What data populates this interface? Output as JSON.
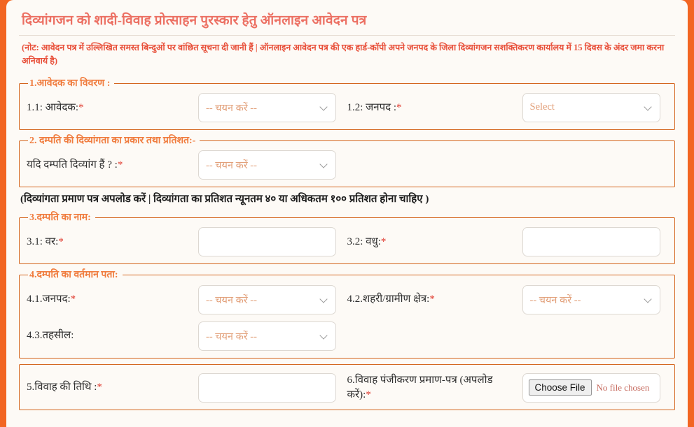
{
  "theme": {
    "page_border": "#f26522",
    "panel_bg": "#fdfaf6",
    "title_color": "#ec7063",
    "note_color": "#e8503a",
    "legend_color": "#f07c3e",
    "fieldset_border": "#d4661f",
    "placeholder_color": "#e2a07a",
    "required_color": "#e03b2f"
  },
  "header": {
    "title": "दिव्यांगजन को शादी-विवाह प्रोत्साहन पुरस्कार हेतु ऑनलाइन आवेदन पत्र",
    "note": "(नोट: आवेदन पत्र में उल्लिखित समस्त बिन्दुओं पर वांछित सूचना दी जानी हैं | ऑनलाइन आवेदन पत्र की एक हार्ड-कॉपी अपने जनपद के जिला दिव्यांगजन सशक्तिकरण कार्यालय में 15 दिवस के अंदर जमा करना अनिवार्य है)"
  },
  "sections": [
    {
      "legend": "1.आवेदक का विवरण :",
      "rows": [
        {
          "left": {
            "label": "1.1: आवेदक:",
            "required": true,
            "control": "select",
            "value": "-- चयन करें --"
          },
          "right": {
            "label": "1.2: जनपद :",
            "required": true,
            "control": "select",
            "value": "Select"
          }
        }
      ]
    },
    {
      "legend": "2. दम्पति की दिव्यांगता का प्रकार तथा प्रतिशत:-",
      "rows": [
        {
          "left": {
            "label": "यदि दम्पति दिव्यांग हैं ? :",
            "required": true,
            "control": "select",
            "value": "-- चयन करें --"
          },
          "right": null
        }
      ]
    },
    {
      "legend": "3.दम्पति का नाम:",
      "rows": [
        {
          "left": {
            "label": "3.1: वर:",
            "required": true,
            "control": "text",
            "value": ""
          },
          "right": {
            "label": "3.2: वधु:",
            "required": true,
            "control": "text",
            "value": ""
          }
        }
      ]
    },
    {
      "legend": "4.दम्पति का वर्तमान पता:",
      "rows": [
        {
          "left": {
            "label": "4.1.जनपद:",
            "required": true,
            "control": "select",
            "value": "-- चयन करें --"
          },
          "right": {
            "label": "4.2.शहरी/ग्रामीण क्षेत्र:",
            "required": true,
            "control": "select",
            "value": "-- चयन करें --"
          }
        },
        {
          "left": {
            "label": "4.3.तहसील:",
            "required": false,
            "control": "select",
            "value": "-- चयन करें --"
          },
          "right": null
        }
      ]
    },
    {
      "legend": "",
      "rows": [
        {
          "left": {
            "label": "5.विवाह की तिथि :",
            "required": true,
            "control": "text",
            "value": ""
          },
          "right": {
            "label": "6.विवाह पंजीकरण प्रमाण-पत्र (अपलोड करें):",
            "required": true,
            "control": "file",
            "value": ""
          }
        }
      ]
    }
  ],
  "inline_note": "(दिव्यांगता प्रमाण पत्र अपलोड करें | दिव्यांगता का प्रतिशत न्यूनतम ४० या अधिकतम १०० प्रतिशत होना चाहिए )",
  "file_input": {
    "button_label": "Choose File",
    "status_text": "No file chosen"
  },
  "required_marker": "*"
}
